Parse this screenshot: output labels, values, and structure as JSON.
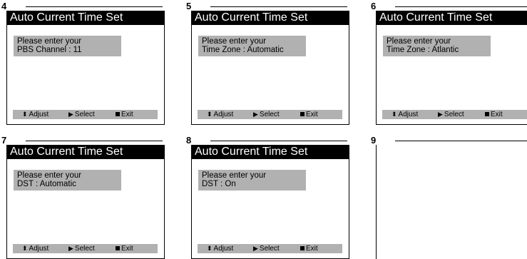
{
  "steps": [
    {
      "number": "4",
      "title": "Auto Current Time Set",
      "line1": "Please enter your",
      "line2": "PBS Channel : 11",
      "footer": {
        "adjust": "Adjust",
        "select": "Select",
        "exit": "Exit"
      }
    },
    {
      "number": "5",
      "title": "Auto Current Time Set",
      "line1": "Please enter your",
      "line2": "Time Zone : Automatic",
      "footer": {
        "adjust": "Adjust",
        "select": "Select",
        "exit": "Exit"
      }
    },
    {
      "number": "6",
      "title": "Auto Current Time Set",
      "line1": "Please enter your",
      "line2": "Time Zone : Atlantic",
      "footer": {
        "adjust": "Adjust",
        "select": "Select",
        "exit": "Exit"
      }
    },
    {
      "number": "7",
      "title": "Auto Current Time Set",
      "line1": "Please enter your",
      "line2": "DST : Automatic",
      "footer": {
        "adjust": "Adjust",
        "select": "Select",
        "exit": "Exit"
      }
    },
    {
      "number": "8",
      "title": "Auto Current Time Set",
      "line1": "Please enter your",
      "line2": "DST : On",
      "footer": {
        "adjust": "Adjust",
        "select": "Select",
        "exit": "Exit"
      }
    },
    {
      "number": "9"
    }
  ],
  "icons": {
    "adjust": "up-down-arrow-icon",
    "select": "right-triangle-icon",
    "exit": "black-square-icon"
  },
  "colors": {
    "title_bar": "#000000",
    "title_text": "#ffffff",
    "message_bg": "#b1b1b1",
    "footer_bg": "#b1b1b1"
  }
}
